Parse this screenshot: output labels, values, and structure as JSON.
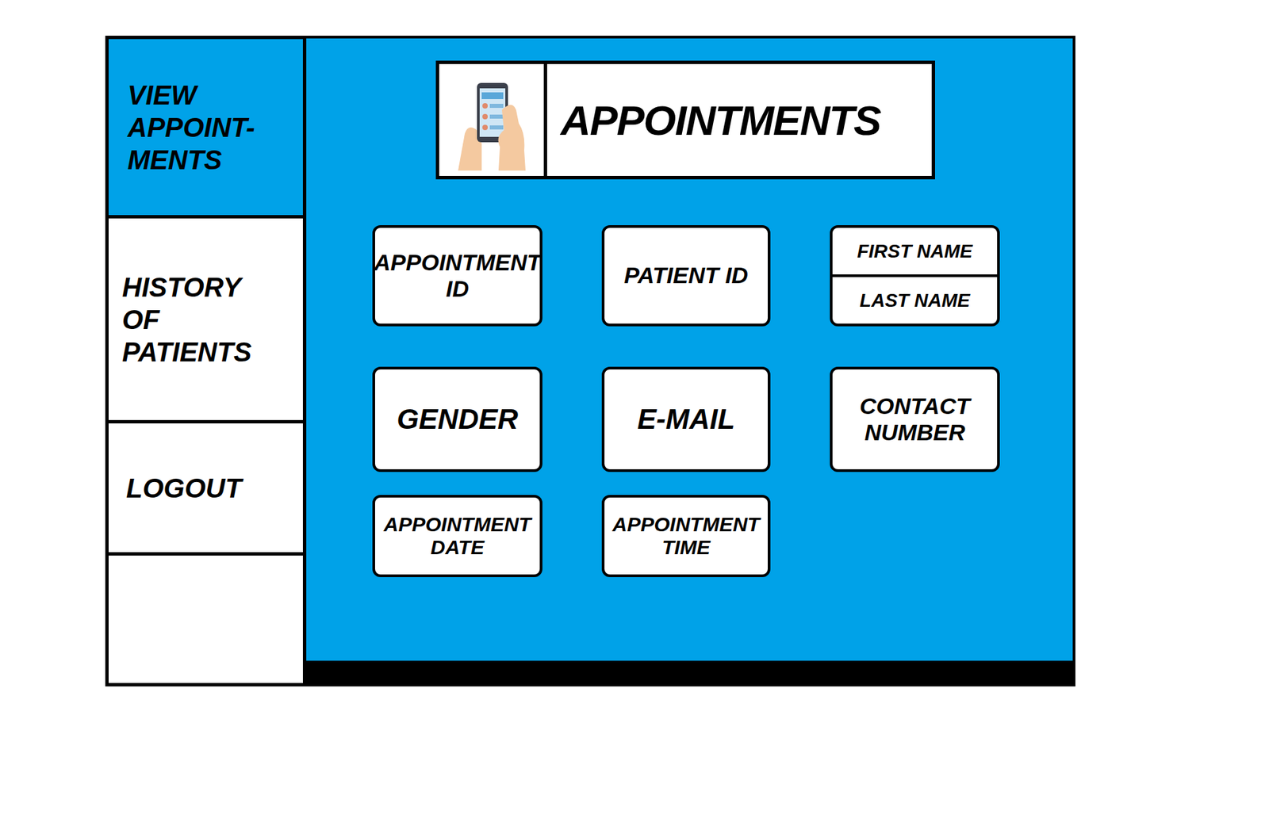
{
  "sidebar": {
    "items": [
      {
        "label": "VIEW APPOINT-MENTS",
        "selected": true
      },
      {
        "label": "HISTORY OF PATIENTS",
        "selected": false
      },
      {
        "label": "LOGOUT",
        "selected": false
      }
    ]
  },
  "header": {
    "title": "APPOINTMENTS"
  },
  "fields": [
    {
      "kind": "single",
      "labels": [
        "APPOINTMENT ID"
      ]
    },
    {
      "kind": "single",
      "labels": [
        "PATIENT ID"
      ]
    },
    {
      "kind": "split",
      "labels": [
        "FIRST NAME",
        "LAST NAME"
      ]
    },
    {
      "kind": "single",
      "labels": [
        "GENDER"
      ]
    },
    {
      "kind": "single",
      "labels": [
        "E-MAIL"
      ]
    },
    {
      "kind": "single",
      "labels": [
        "CONTACT NUMBER"
      ]
    },
    {
      "kind": "single",
      "labels": [
        "APPOINTMENT DATE"
      ]
    },
    {
      "kind": "single",
      "labels": [
        "APPOINTMENT TIME"
      ]
    }
  ]
}
